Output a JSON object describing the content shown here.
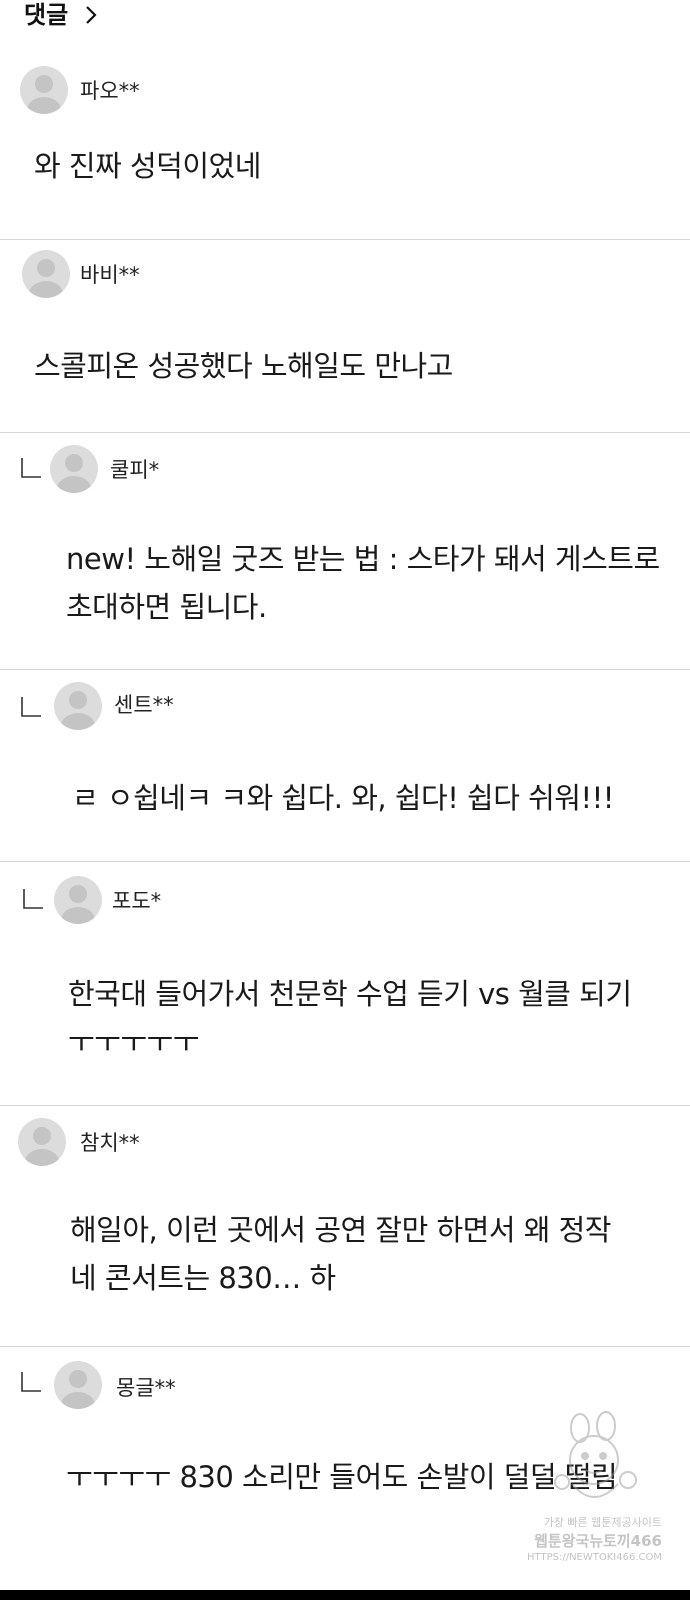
{
  "header": {
    "title": "댓글",
    "chevron_icon": "chevron-right-icon"
  },
  "comments": [
    {
      "author": "파오**",
      "is_reply": false,
      "lines": [
        "와 진짜 성덕이었네"
      ]
    },
    {
      "author": "바비**",
      "is_reply": false,
      "lines": [
        "스콜피온 성공했다 노해일도 만나고"
      ]
    },
    {
      "author": "쿨피*",
      "is_reply": true,
      "lines": [
        "new! 노해일 굿즈 받는 법 : 스타가 돼서 게스트로",
        "초대하면 됩니다."
      ]
    },
    {
      "author": "센트**",
      "is_reply": true,
      "lines": [
        "ㄹ ㅇ쉽네ㅋ ㅋ와 쉽다. 와, 쉽다! 쉽다 쉬워!!!"
      ]
    },
    {
      "author": "포도*",
      "is_reply": true,
      "lines": [
        "한국대 들어가서 천문학 수업 듣기 vs 월클 되기",
        "ㅜㅜㅜㅜㅜ"
      ]
    },
    {
      "author": "참치**",
      "is_reply": false,
      "lines": [
        "해일아, 이런 곳에서 공연 잘만 하면서 왜 정작",
        "네 콘서트는 830… 하"
      ]
    },
    {
      "author": "몽글**",
      "is_reply": true,
      "lines": [
        "ㅜㅜㅜㅜ 830 소리만 들어도 손발이 덜덜 떨림"
      ]
    }
  ],
  "watermark": {
    "line1": "가장 빠른 웹툰제공사이트",
    "line2": "웹툰왕국뉴토끼466",
    "line3": "HTTPS://NEWTOKI466.COM"
  },
  "colors": {
    "divider": "#d6d6d6",
    "avatar": "#dcdcdc",
    "text": "#1a1a1a",
    "bottom_bar": "#000000"
  }
}
